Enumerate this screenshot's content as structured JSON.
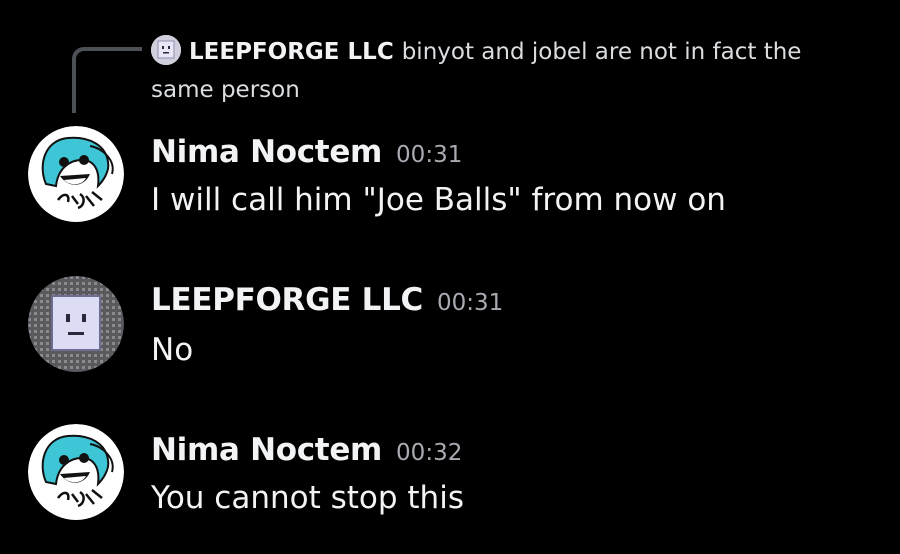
{
  "reply": {
    "author": "LEEPFORGE LLC",
    "text_line1": "binyot and jobel are not in fact the",
    "text_line2": "same person",
    "avatar_icon": "robot-face-icon"
  },
  "messages": [
    {
      "author": "Nima Noctem",
      "timestamp": "00:31",
      "text": "I will call him \"Joe Balls\" from now on",
      "avatar_icon": "cyan-hair-character-avatar"
    },
    {
      "author": "LEEPFORGE LLC",
      "timestamp": "00:31",
      "text": "No",
      "avatar_icon": "robot-face-icon"
    },
    {
      "author": "Nima Noctem",
      "timestamp": "00:32",
      "text": "You cannot stop this",
      "avatar_icon": "cyan-hair-character-avatar"
    }
  ],
  "colors": {
    "background": "#000000",
    "author": "#f2f3f5",
    "timestamp": "#a9abb2",
    "reply_line": "#4e5058",
    "character_hair": "#3ec6d6"
  }
}
